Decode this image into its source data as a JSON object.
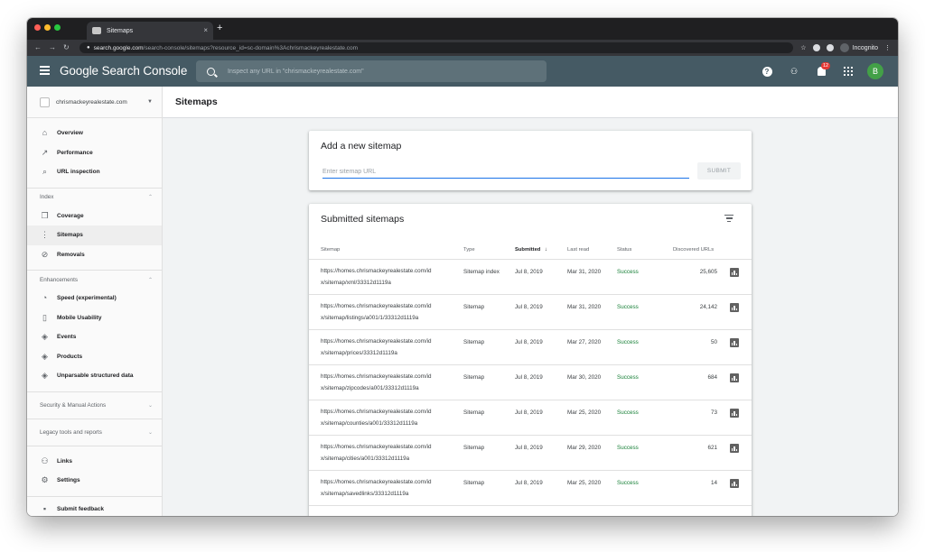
{
  "browser": {
    "tab_title": "Sitemaps",
    "tab_close": "×",
    "new_tab": "+",
    "url_host": "search.google.com",
    "url_path": "/search-console/sitemaps?resource_id=sc-domain%3Achrismackeyrealestate.com",
    "incognito_label": "Incognito",
    "back_glyph": "←",
    "forward_glyph": "→",
    "reload_glyph": "↻",
    "star_glyph": "☆",
    "menu_glyph": "⋮"
  },
  "appbar": {
    "brand": "Google Search Console",
    "search_placeholder": "Inspect any URL in \"chrismackeyrealestate.com\"",
    "help_label": "?",
    "notification_count": "12",
    "user_initial": "B"
  },
  "sidebar": {
    "property": "chrismackeyrealestate.com",
    "top_items": [
      {
        "label": "Overview",
        "icon": "home-icon",
        "glyph": "⌂"
      },
      {
        "label": "Performance",
        "icon": "trending-up-icon",
        "glyph": "↗"
      },
      {
        "label": "URL inspection",
        "icon": "search-icon",
        "glyph": "⌕"
      }
    ],
    "index_title": "Index",
    "index_items": [
      {
        "label": "Coverage",
        "icon": "coverage-icon",
        "glyph": "❐"
      },
      {
        "label": "Sitemaps",
        "icon": "sitemap-icon",
        "glyph": "⋮"
      },
      {
        "label": "Removals",
        "icon": "removals-icon",
        "glyph": "⊘"
      }
    ],
    "enh_title": "Enhancements",
    "enh_items": [
      {
        "label": "Speed (experimental)",
        "icon": "speed-icon",
        "glyph": "◔"
      },
      {
        "label": "Mobile Usability",
        "icon": "phone-icon",
        "glyph": "▯"
      },
      {
        "label": "Events",
        "icon": "layers-icon",
        "glyph": "◈"
      },
      {
        "label": "Products",
        "icon": "layers-icon",
        "glyph": "◈"
      },
      {
        "label": "Unparsable structured data",
        "icon": "layers-icon",
        "glyph": "◈"
      }
    ],
    "security_title": "Security & Manual Actions",
    "legacy_title": "Legacy tools and reports",
    "bottom_items": [
      {
        "label": "Links",
        "icon": "links-icon",
        "glyph": "⚇"
      },
      {
        "label": "Settings",
        "icon": "gear-icon",
        "glyph": "⚙"
      }
    ],
    "feedback": {
      "label": "Submit feedback",
      "icon": "feedback-icon",
      "glyph": "▪"
    },
    "expand_glyph": "⌃",
    "collapse_glyph": "⌄",
    "dropdown_glyph": "▼"
  },
  "main": {
    "title": "Sitemaps",
    "add_card": {
      "title": "Add a new sitemap",
      "input_placeholder": "Enter sitemap URL",
      "submit_label": "SUBMIT"
    },
    "list_card": {
      "title": "Submitted sitemaps",
      "columns": [
        "Sitemap",
        "Type",
        "Submitted",
        "Last read",
        "Status",
        "Discovered URLs"
      ],
      "sort_glyph": "↓",
      "rows": [
        {
          "url1": "https://homes.chrismackeyrealestate.com/id",
          "url2": "x/sitemap/xml/33312d1119a",
          "type": "Sitemap index",
          "submitted": "Jul 8, 2019",
          "last_read": "Mar 31, 2020",
          "status": "Success",
          "urls": "25,605"
        },
        {
          "url1": "https://homes.chrismackeyrealestate.com/id",
          "url2": "x/sitemap/listings/a001/1/33312d1119a",
          "type": "Sitemap",
          "submitted": "Jul 8, 2019",
          "last_read": "Mar 31, 2020",
          "status": "Success",
          "urls": "24,142"
        },
        {
          "url1": "https://homes.chrismackeyrealestate.com/id",
          "url2": "x/sitemap/prices/33312d1119a",
          "type": "Sitemap",
          "submitted": "Jul 8, 2019",
          "last_read": "Mar 27, 2020",
          "status": "Success",
          "urls": "50"
        },
        {
          "url1": "https://homes.chrismackeyrealestate.com/id",
          "url2": "x/sitemap/zipcodes/a001/33312d1119a",
          "type": "Sitemap",
          "submitted": "Jul 8, 2019",
          "last_read": "Mar 30, 2020",
          "status": "Success",
          "urls": "684"
        },
        {
          "url1": "https://homes.chrismackeyrealestate.com/id",
          "url2": "x/sitemap/counties/a001/33312d1119a",
          "type": "Sitemap",
          "submitted": "Jul 8, 2019",
          "last_read": "Mar 25, 2020",
          "status": "Success",
          "urls": "73"
        },
        {
          "url1": "https://homes.chrismackeyrealestate.com/id",
          "url2": "x/sitemap/cities/a001/33312d1119a",
          "type": "Sitemap",
          "submitted": "Jul 8, 2019",
          "last_read": "Mar 29, 2020",
          "status": "Success",
          "urls": "621"
        },
        {
          "url1": "https://homes.chrismackeyrealestate.com/id",
          "url2": "x/sitemap/savedlinks/33312d1119a",
          "type": "Sitemap",
          "submitted": "Jul 8, 2019",
          "last_read": "Mar 25, 2020",
          "status": "Success",
          "urls": "14"
        }
      ]
    }
  },
  "colors": {
    "appbar": "#455a64",
    "success": "#188038",
    "accent": "#1a73e8",
    "avatar": "#43a047",
    "badge": "#e53935"
  }
}
